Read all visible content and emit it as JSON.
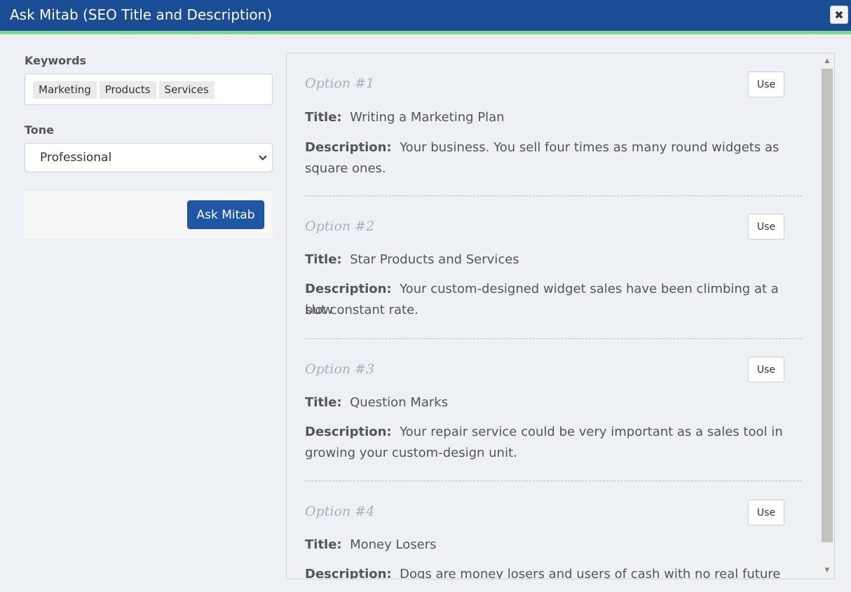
{
  "dialog": {
    "title": "Ask Mitab (SEO Title and Description)",
    "close_symbol": "✖",
    "accent_color": "#1b4d94",
    "stripe_color": "#7dd88b"
  },
  "form": {
    "keywords_label": "Keywords",
    "keywords": [
      "Marketing",
      "Products",
      "Services"
    ],
    "tone_label": "Tone",
    "tone_value": "Professional",
    "ask_button": "Ask Mitab"
  },
  "results": {
    "title_label": "Title:",
    "description_label": "Description:",
    "use_label": "Use",
    "options": [
      {
        "name": "Option #1",
        "title": "Writing a Marketing Plan",
        "description_line1": "Your business. You sell four times as many round widgets as",
        "description_line2": "square ones."
      },
      {
        "name": "Option #2",
        "title": "Star Products and Services",
        "description_line1": "Your custom-designed widget sales have been climbing at a slow",
        "description_line2": "but constant rate."
      },
      {
        "name": "Option #3",
        "title": "Question Marks",
        "description_line1": "Your repair service could be very important as a sales tool in",
        "description_line2": "growing your custom-design unit."
      },
      {
        "name": "Option #4",
        "title": "Money Losers",
        "description_line1": "Dogs are money losers and users of cash with no real future",
        "description_line2": ""
      }
    ]
  },
  "icons": {
    "chevron": "chevron-down-icon",
    "scroll_up": "▲",
    "scroll_down": "▼"
  }
}
